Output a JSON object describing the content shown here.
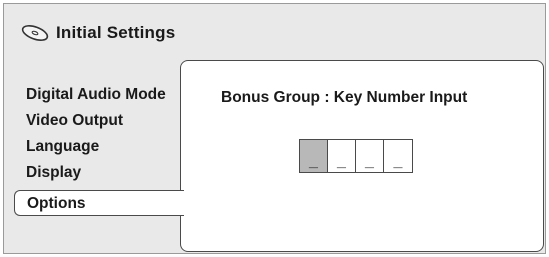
{
  "header": {
    "icon": "disc-icon",
    "title": "Initial Settings"
  },
  "menu": {
    "items": [
      {
        "label": "Digital Audio Mode",
        "selected": false
      },
      {
        "label": "Video Output",
        "selected": false
      },
      {
        "label": "Language",
        "selected": false
      },
      {
        "label": "Display",
        "selected": false
      },
      {
        "label": "Options",
        "selected": true
      }
    ]
  },
  "panel": {
    "title": "Bonus Group : Key Number Input",
    "digits": [
      "_",
      "_",
      "_",
      "_"
    ],
    "active_digit": 1
  },
  "colors": {
    "background": "#e9e9e9",
    "panel": "#ffffff",
    "active_digit": "#b8b8b8",
    "border": "#4a4a4a"
  }
}
